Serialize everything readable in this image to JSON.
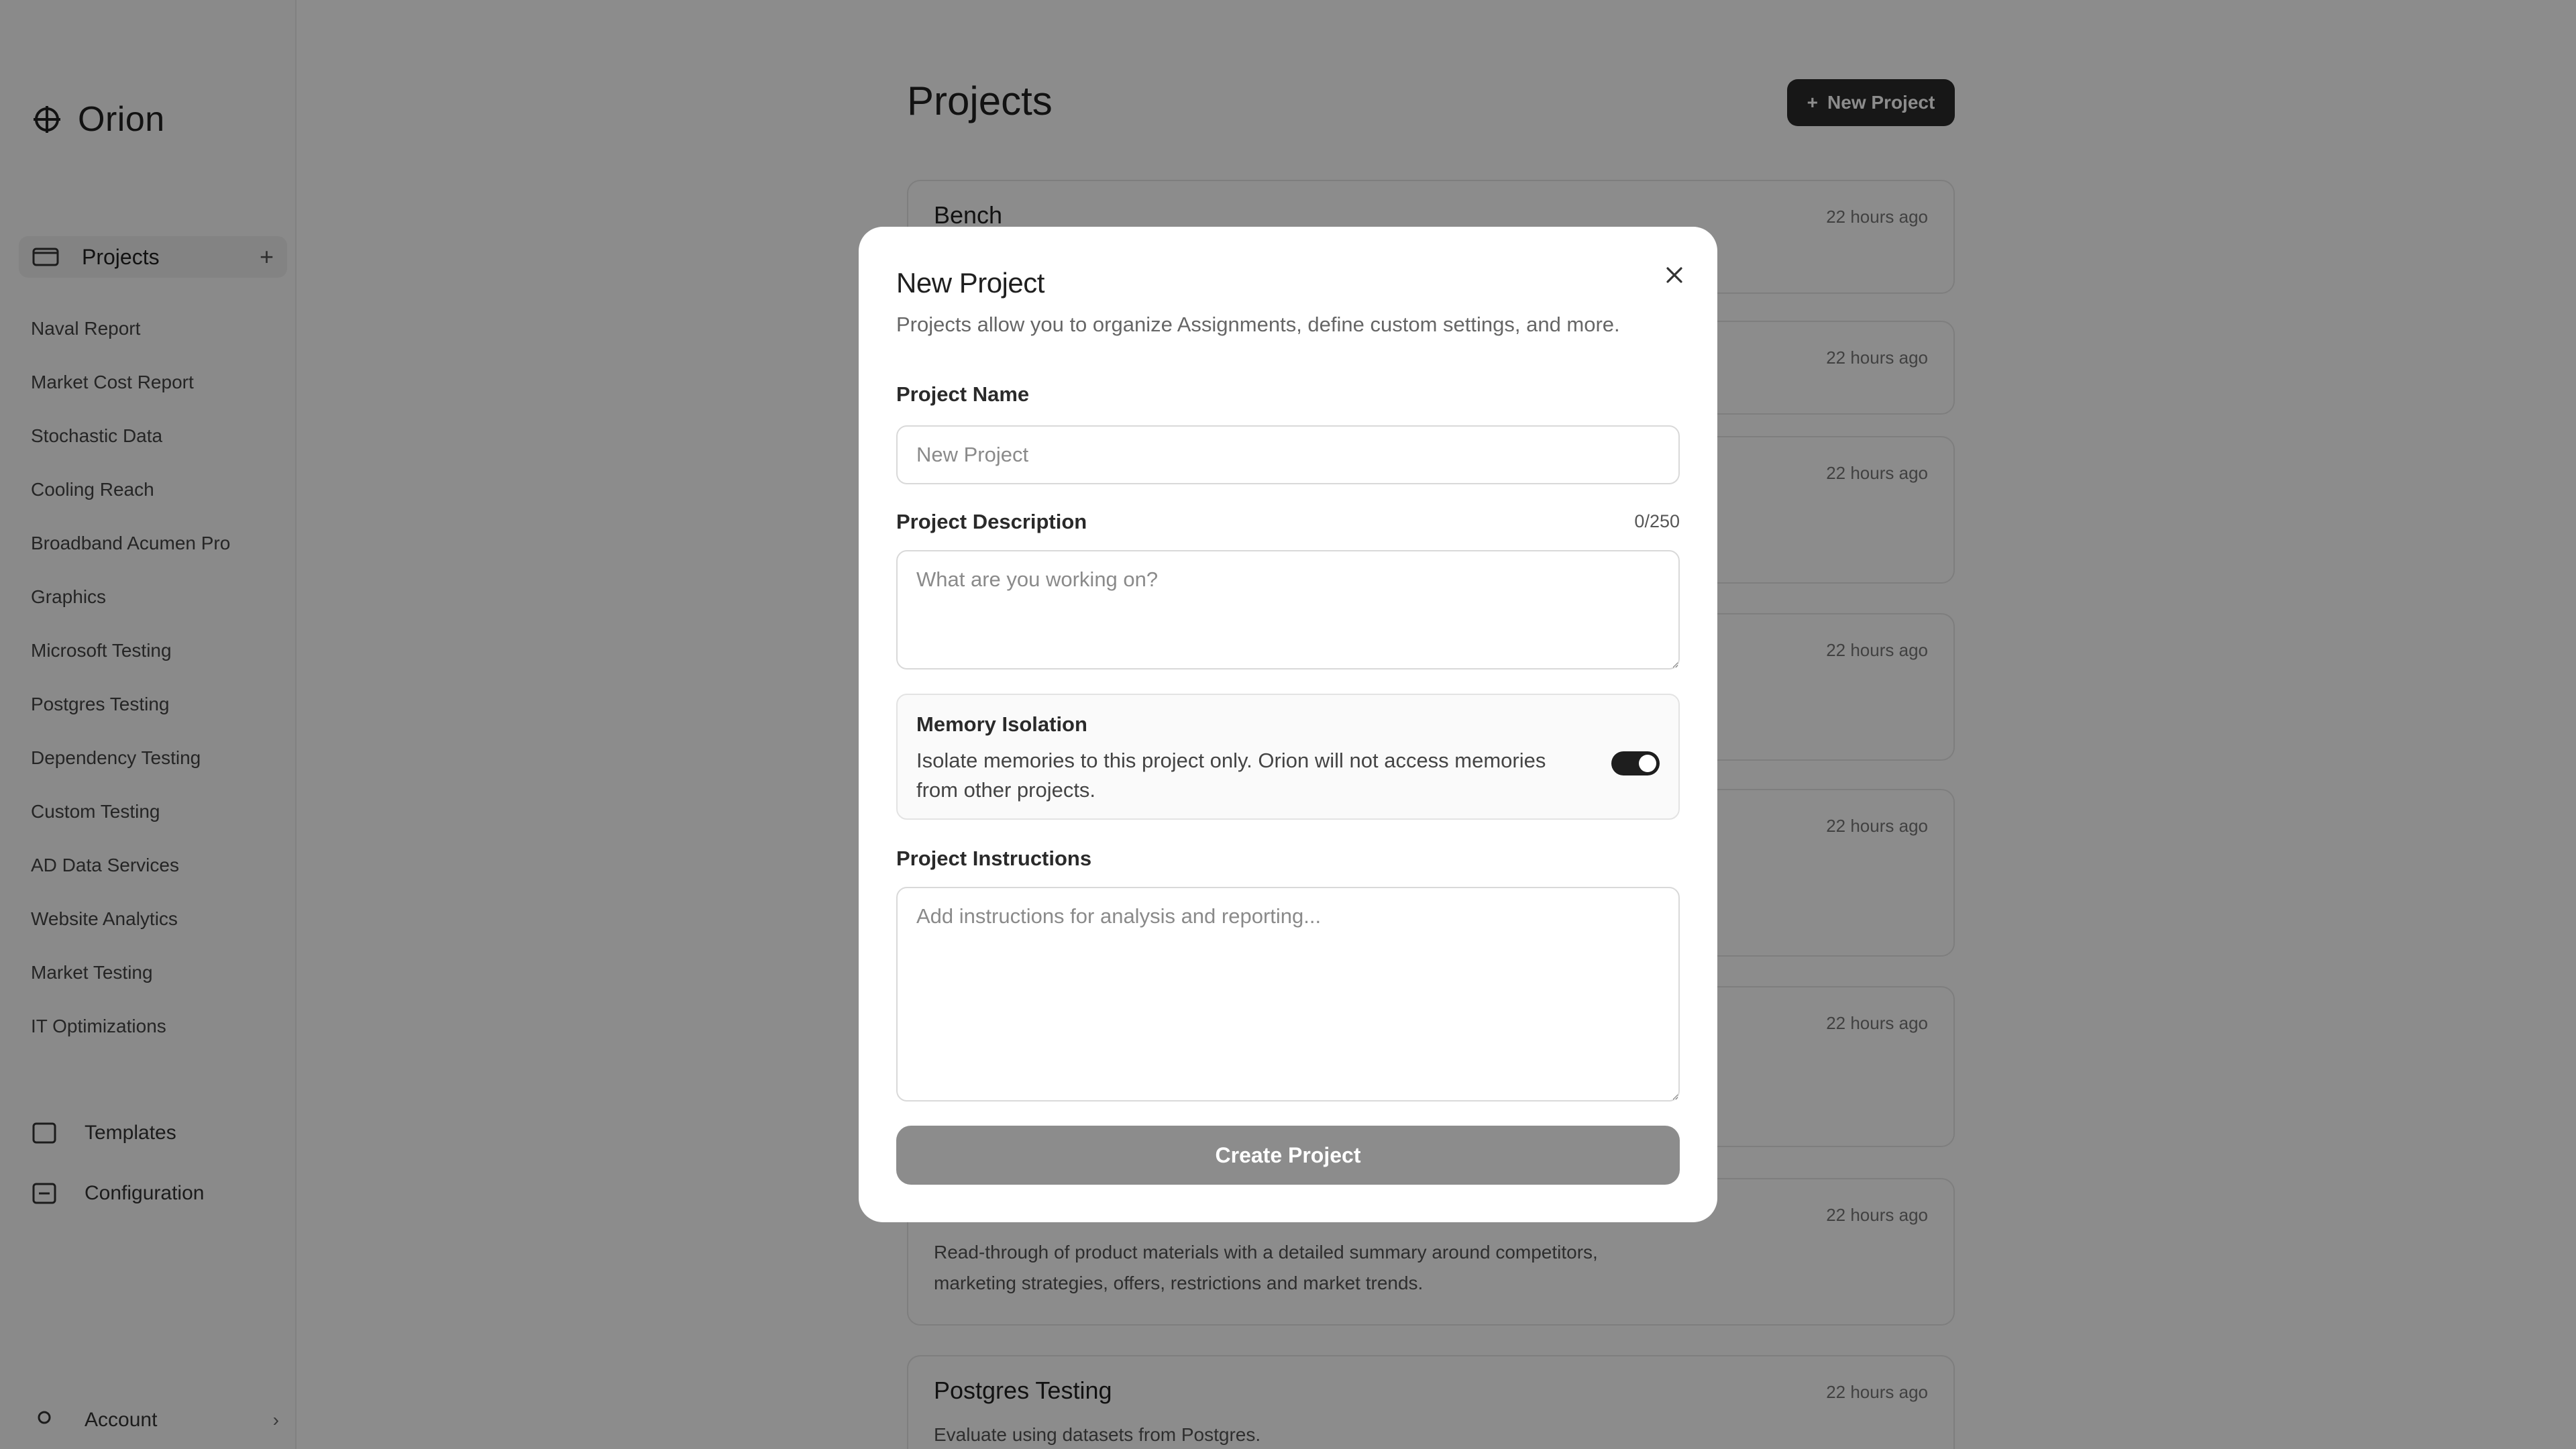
{
  "app": {
    "name": "Orion"
  },
  "sidebar": {
    "projects_label": "Projects",
    "projects": [
      "Naval Report",
      "Market Cost Report",
      "Stochastic Data",
      "Cooling Reach",
      "Broadband Acumen Pro",
      "Graphics",
      "Microsoft Testing",
      "Postgres Testing",
      "Dependency Testing",
      "Custom Testing",
      "AD Data Services",
      "Website Analytics",
      "Market Testing",
      "IT Optimizations"
    ],
    "templates_label": "Templates",
    "config_label": "Configuration",
    "account_label": "Account"
  },
  "main": {
    "title": "Projects",
    "new_button_label": "New Project",
    "cards": [
      {
        "title": "Bench",
        "time": "22 hours ago"
      },
      {
        "title": "",
        "time": "22 hours ago"
      },
      {
        "title": "",
        "time": "22 hours ago"
      },
      {
        "title": "",
        "time": "22 hours ago"
      },
      {
        "title": "",
        "time": "22 hours ago"
      },
      {
        "title": "",
        "time": "22 hours ago"
      },
      {
        "title": "",
        "time": "22 hours ago",
        "desc": "Read-through of product materials with a detailed summary around competitors, marketing strategies, offers, restrictions and market trends."
      },
      {
        "title": "Postgres Testing",
        "time": "22 hours ago",
        "desc": "Evaluate using datasets from Postgres."
      }
    ]
  },
  "modal": {
    "title": "New Project",
    "subtitle": "Projects allow you to organize Assignments, define custom settings, and more.",
    "name_label": "Project Name",
    "name_placeholder": "New Project",
    "name_value": "",
    "desc_label": "Project Description",
    "desc_counter": "0/250",
    "desc_placeholder": "What are you working on?",
    "memory_title": "Memory Isolation",
    "memory_desc": "Isolate memories to this project only. Orion will not access memories from other projects.",
    "memory_enabled": true,
    "instructions_label": "Project Instructions",
    "instructions_placeholder": "Add instructions for analysis and reporting...",
    "create_label": "Create Project"
  }
}
